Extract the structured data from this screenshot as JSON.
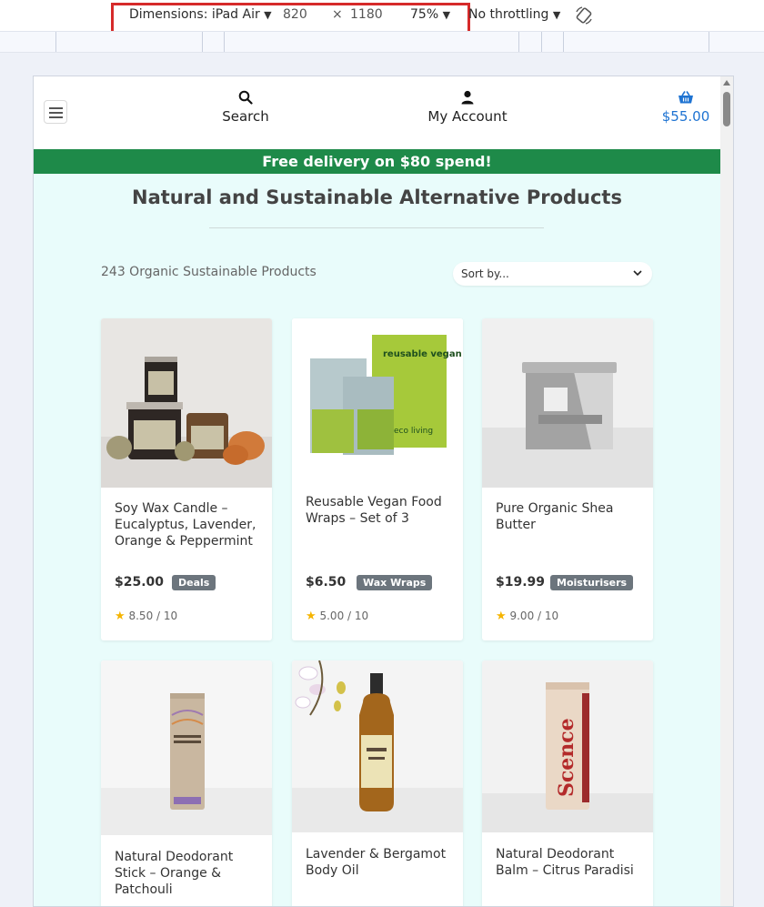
{
  "devtools": {
    "dimensions_label": "Dimensions: iPad Air",
    "width": "820",
    "times": "×",
    "height": "1180",
    "zoom": "75%",
    "throttling": "No throttling"
  },
  "header": {
    "search_label": "Search",
    "account_label": "My Account",
    "cart_total": "$55.00"
  },
  "banner": {
    "text": "Free delivery on $80 spend!"
  },
  "main": {
    "title": "Natural and Sustainable Alternative Products",
    "product_count": "243 Organic Sustainable Products",
    "sort_placeholder": "Sort by..."
  },
  "products": [
    {
      "name": "Soy Wax Candle – Eucalyptus, Lavender, Orange & Peppermint",
      "price": "$25.00",
      "category": "Deals",
      "rating": "8.50 / 10"
    },
    {
      "name": "Reusable Vegan Food Wraps – Set of 3",
      "price": "$6.50",
      "category": "Wax Wraps",
      "rating": "5.00 / 10",
      "package_title": "reusable vegan food wraps",
      "package_brand": "eco living"
    },
    {
      "name": "Pure Organic Shea Butter",
      "price": "$19.99",
      "category": "Moisturisers",
      "rating": "9.00 / 10"
    },
    {
      "name": "Natural Deodorant Stick – Orange & Patchouli",
      "price": "",
      "category": "",
      "rating": ""
    },
    {
      "name": "Lavender & Bergamot Body Oil",
      "price": "",
      "category": "",
      "rating": ""
    },
    {
      "name": "Natural Deodorant Balm – Citrus Paradisi",
      "price": "",
      "category": "",
      "rating": "",
      "package_brand": "Scence"
    }
  ],
  "colors": {
    "banner": "#1e8a49",
    "page_bg": "#e9fcfb",
    "cart": "#1e73d2",
    "badge": "#6c757d",
    "star": "#f5b400"
  },
  "icons": [
    "hamburger-icon",
    "search-icon",
    "user-icon",
    "basket-icon",
    "chevron-down-icon",
    "star-icon",
    "rotate-icon"
  ]
}
